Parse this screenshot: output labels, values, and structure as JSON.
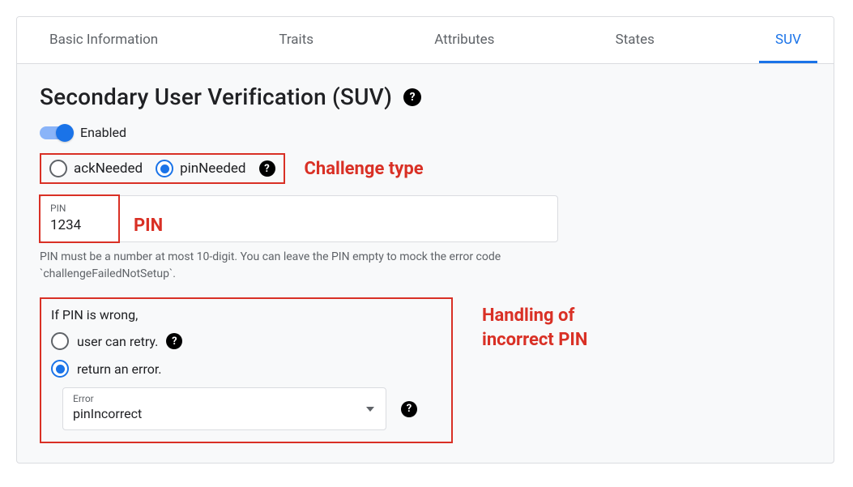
{
  "tabs": [
    {
      "label": "Basic Information",
      "active": false
    },
    {
      "label": "Traits",
      "active": false
    },
    {
      "label": "Attributes",
      "active": false
    },
    {
      "label": "States",
      "active": false
    },
    {
      "label": "SUV",
      "active": true
    }
  ],
  "page": {
    "title": "Secondary User Verification (SUV)"
  },
  "toggle": {
    "label": "Enabled",
    "on": true
  },
  "challenge": {
    "options": {
      "ack": "ackNeeded",
      "pin": "pinNeeded"
    },
    "selected": "pinNeeded",
    "annotation": "Challenge type"
  },
  "pin": {
    "field_label": "PIN",
    "value": "1234",
    "annotation": "PIN",
    "helper": "PIN must be a number at most 10-digit. You can leave the PIN empty to mock the error code `challengeFailedNotSetup`."
  },
  "handling": {
    "prompt": "If PIN is wrong,",
    "options": {
      "retry": "user can retry.",
      "error": "return an error."
    },
    "selected": "return an error.",
    "select": {
      "label": "Error",
      "value": "pinIncorrect"
    },
    "annotation_line1": "Handling of",
    "annotation_line2": "incorrect PIN"
  }
}
